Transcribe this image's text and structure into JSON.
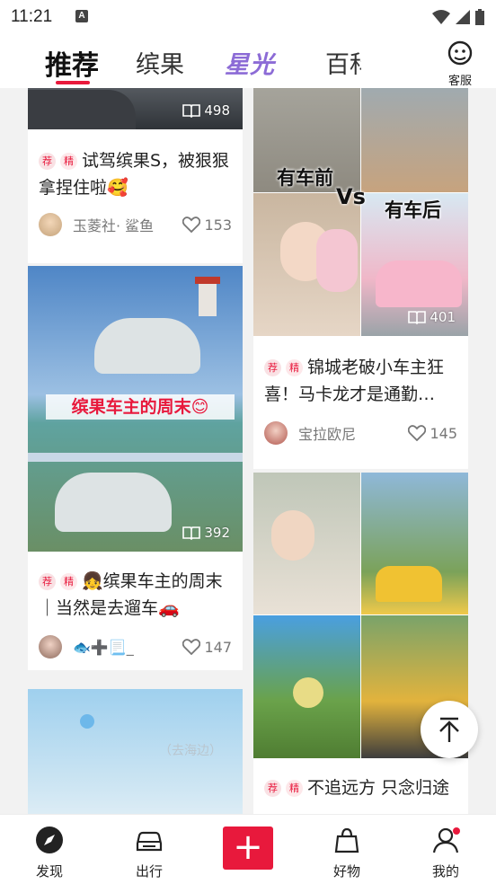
{
  "status": {
    "time": "11:21",
    "notif_icon": "A"
  },
  "tabs": [
    {
      "label": "推荐"
    },
    {
      "label": "缤果"
    },
    {
      "label": "星光"
    },
    {
      "label": "百科"
    }
  ],
  "customer_service": "客服",
  "cards": [
    {
      "reads": "498",
      "tag1": "荐",
      "tag2": "精",
      "title": "试驾缤果S，被狠狠拿捏住啦🥰",
      "author": "玉菱社· 鲨鱼",
      "likes": "153"
    },
    {
      "reads": "392",
      "banner": "缤果车主的周末😊",
      "tag1": "荐",
      "tag2": "精",
      "title": "👧缤果车主的周末｜当然是去遛车🚗",
      "author": "🐟➕📃_",
      "likes": "147"
    },
    {
      "overlay": "（去海边）"
    },
    {
      "reads": "401",
      "overlay_left": "有车前",
      "overlay_vs": "Vs",
      "overlay_right": "有车后",
      "tag1": "荐",
      "tag2": "精",
      "title": "锦城老破小车主狂喜！马卡龙才是通勤…",
      "author": "宝拉欧尼",
      "likes": "145"
    },
    {
      "tag1": "荐",
      "tag2": "精",
      "title": "不追远方 只念归途"
    }
  ],
  "bottom_nav": [
    {
      "label": "发现",
      "icon": "compass-icon"
    },
    {
      "label": "出行",
      "icon": "car-icon"
    },
    {
      "label": "+",
      "icon": "plus-icon"
    },
    {
      "label": "好物",
      "icon": "shopping-bag-icon"
    },
    {
      "label": "我的",
      "icon": "profile-icon"
    }
  ],
  "colors": {
    "accent": "#e8193c",
    "star": "#8c6bd6"
  }
}
